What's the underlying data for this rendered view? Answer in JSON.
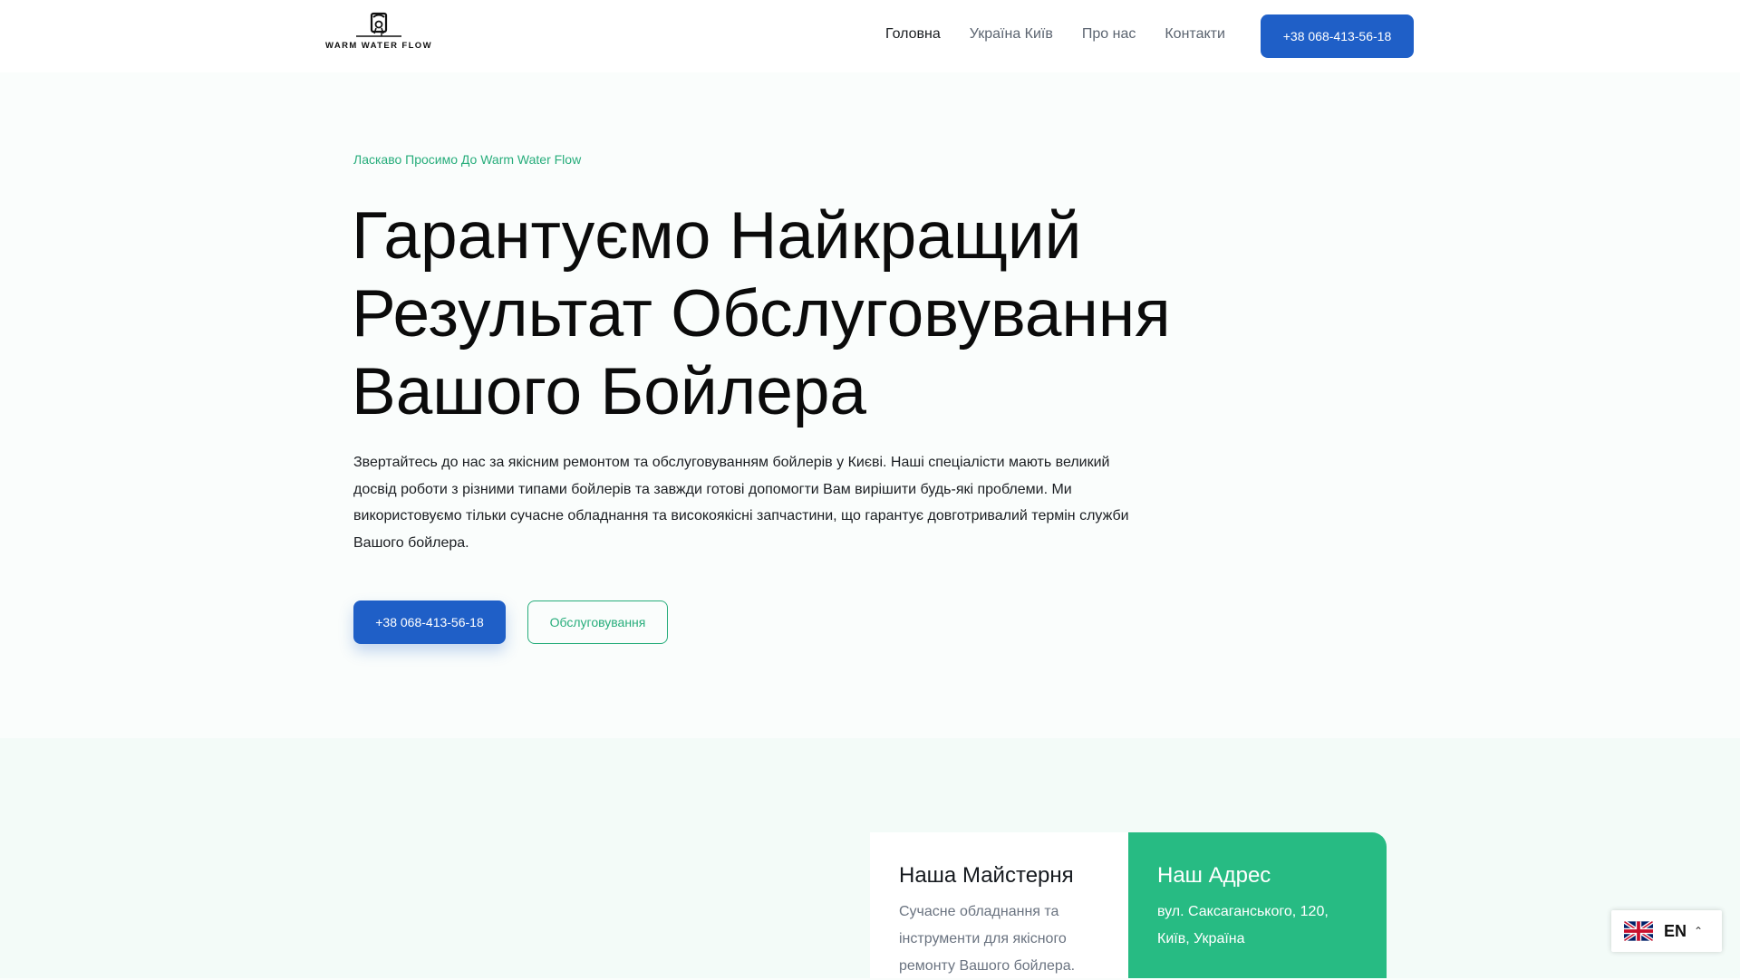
{
  "header": {
    "logo_text": "WARM WATER FLOW",
    "nav": [
      {
        "label": "Головна",
        "active": true
      },
      {
        "label": "Україна Київ",
        "active": false
      },
      {
        "label": "Про нас",
        "active": false
      },
      {
        "label": "Контакти",
        "active": false
      }
    ],
    "phone_button": "+38 068-413-56-18"
  },
  "hero": {
    "eyebrow": "Ласкаво Просимо До Warm Water Flow",
    "title": "Гарантуємо Найкращий Результат Обслуговування Вашого Бойлера",
    "text": "Звертайтесь до нас за якісним ремонтом та обслуговуванням бойлерів у Києві. Наші спеціалісти мають великий досвід роботи з різними типами бойлерів та завжди готові допомогти Вам вирішити будь-які проблеми. Ми використовуємо тільки сучасне обладнання та високоякісні запчастини, що гарантує довготривалий термін служби Вашого бойлера.",
    "phone_button": "+38 068-413-56-18",
    "service_button": "Обслуговування"
  },
  "cards": {
    "workshop": {
      "title": "Наша Майстерня",
      "text": "Сучасне обладнання та інструменти для якісного ремонту Вашого бойлера."
    },
    "address": {
      "title": "Наш Адрес",
      "text": "вул. Саксаганського, 120, Київ, Україна"
    }
  },
  "language_switcher": {
    "code": "EN",
    "flag_icon": "uk-flag-icon",
    "caret_icon": "chevron-up-icon"
  },
  "colors": {
    "accent_green": "#27bb83",
    "primary_blue": "#1f5fc7"
  }
}
